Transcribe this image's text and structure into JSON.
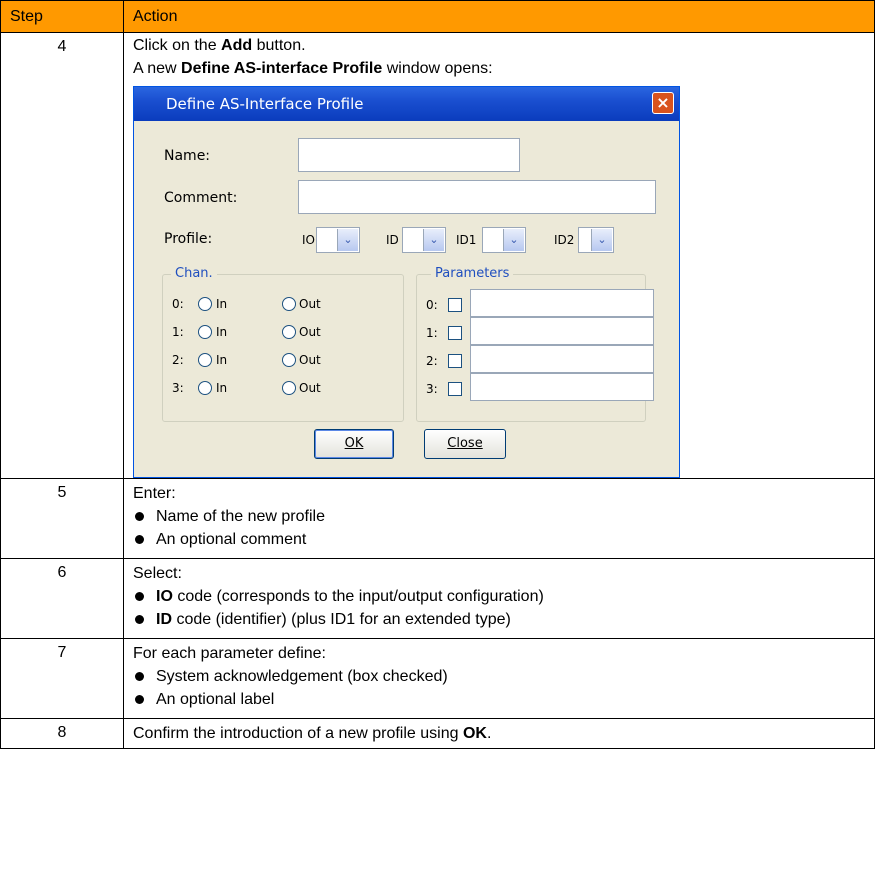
{
  "table": {
    "header": {
      "step": "Step",
      "action": "Action"
    },
    "rows": [
      {
        "step": "4",
        "line1_pre": "Click on the ",
        "line1_bold": "Add",
        "line1_post": " button.",
        "line2_pre": "A new ",
        "line2_bold": "Define AS-interface Profile",
        "line2_post": " window opens:"
      },
      {
        "step": "5",
        "intro": "Enter:",
        "bullets": [
          "Name of the new profile",
          "An optional comment"
        ]
      },
      {
        "step": "6",
        "intro": "Select:",
        "b1_bold": "IO",
        "b1_text": " code (corresponds to the input/output configuration)",
        "b2_bold": "ID",
        "b2_text": " code (identifier) (plus ID1 for an extended type)"
      },
      {
        "step": "7",
        "intro": "For each parameter define:",
        "bullets": [
          "System acknowledgement (box checked)",
          "An optional label"
        ]
      },
      {
        "step": "8",
        "text_pre": "Confirm the introduction of a new profile using ",
        "text_bold": "OK",
        "text_post": "."
      }
    ]
  },
  "dialog": {
    "title": "Define AS-Interface Profile",
    "name_label": "Name:",
    "comment_label": "Comment:",
    "profile_label": "Profile:",
    "profile_fields": [
      "IO",
      "ID",
      "ID1",
      "ID2"
    ],
    "chan_group": "Chan.",
    "params_group": "Parameters",
    "channels": [
      "0:",
      "1:",
      "2:",
      "3:"
    ],
    "in_label": "In",
    "out_label": "Out",
    "params": [
      "0:",
      "1:",
      "2:",
      "3:"
    ],
    "ok_label": "OK",
    "close_label": "Close",
    "close_icon": "×",
    "combo_arrow": "⌄"
  }
}
